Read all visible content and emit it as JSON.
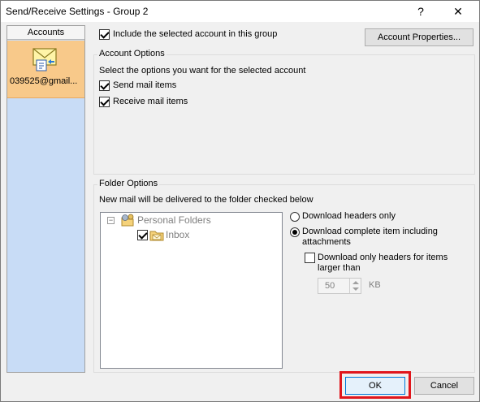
{
  "window": {
    "title": "Send/Receive Settings - Group 2",
    "help_label": "?",
    "close_label": "✕"
  },
  "accounts": {
    "header": "Accounts",
    "items": [
      {
        "label": "039525@gmail...",
        "icon": "mail-account-icon",
        "selected": true
      }
    ]
  },
  "include": {
    "label": "Include the selected account in this group",
    "checked": true
  },
  "account_properties_button": "Account Properties...",
  "account_options": {
    "title": "Account Options",
    "description": "Select the options you want for the selected account",
    "send_label": "Send mail items",
    "send_checked": true,
    "receive_label": "Receive mail items",
    "receive_checked": true
  },
  "folder_options": {
    "title": "Folder Options",
    "description": "New mail will be delivered to the folder checked below",
    "tree": {
      "expander": "−",
      "root_label": "Personal Folders",
      "root_icon": "personal-folders-icon",
      "child_label": "Inbox",
      "child_icon": "inbox-folder-icon",
      "child_checked": true
    },
    "radio_headers": "Download headers only",
    "radio_complete": "Download complete item including attachments",
    "selected_radio": "complete",
    "limit_label": "Download only headers for items larger than",
    "limit_checked": false,
    "size_value": "50",
    "size_unit": "KB"
  },
  "buttons": {
    "ok": "OK",
    "cancel": "Cancel"
  },
  "highlight_color": "#e0161c"
}
